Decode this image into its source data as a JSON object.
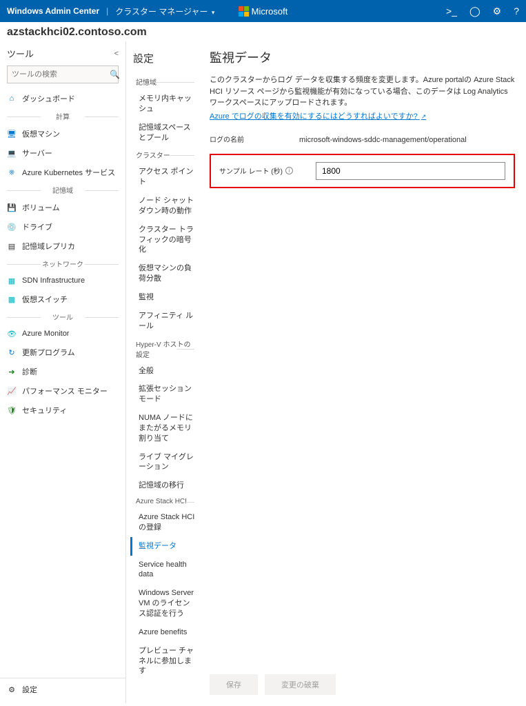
{
  "header": {
    "product": "Windows Admin Center",
    "context": "クラスター マネージャー",
    "brand": "Microsoft"
  },
  "cluster_name": "azstackhci02.contoso.com",
  "tools": {
    "title": "ツール",
    "search_placeholder": "ツールの検索",
    "items": {
      "dashboard": "ダッシュボード",
      "section_compute": "計算",
      "vm": "仮想マシン",
      "server": "サーバー",
      "aks": "Azure Kubernetes サービス",
      "section_storage": "記憶域",
      "volume": "ボリューム",
      "drive": "ドライブ",
      "storage_replica": "記憶域レプリカ",
      "section_network": "ネットワーク",
      "sdn": "SDN Infrastructure",
      "vswitch": "仮想スイッチ",
      "section_tool": "ツール",
      "azmon": "Azure Monitor",
      "updates": "更新プログラム",
      "diag": "診断",
      "perfmon": "パフォーマンス モニター",
      "security": "セキュリティ"
    },
    "footer": "設定"
  },
  "settings": {
    "title": "設定",
    "sections": {
      "storage": "記憶域",
      "cluster": "クラスター",
      "hyperv": "Hyper-V ホストの設定",
      "azurehci": "Azure Stack HCI"
    },
    "items": {
      "mem_cache": "メモリ内キャッシュ",
      "storage_space": "記憶域スペースとプール",
      "access_point": "アクセス ポイント",
      "node_shutdown": "ノード シャットダウン時の動作",
      "traffic_enc": "クラスター トラフィックの暗号化",
      "vm_lb": "仮想マシンの負荷分散",
      "monitoring": "監視",
      "affinity": "アフィニティ ルール",
      "general": "全般",
      "enh_session": "拡張セッション モード",
      "numa": "NUMA ノードにまたがるメモリ割り当て",
      "live_mig": "ライブ マイグレーション",
      "storage_mig": "記憶域の移行",
      "hci_reg": "Azure Stack HCI の登録",
      "monitor_data": "監視データ",
      "svc_health": "Service health data",
      "ws_vm_lic": "Windows Server VM のライセンス認証を行う",
      "az_benefits": "Azure benefits",
      "preview": "プレビュー チャネルに参加します"
    }
  },
  "main": {
    "title": "監視データ",
    "description": "このクラスターからログ データを収集する頻度を変更します。Azure portalの Azure Stack HCI リソース ページから監視機能が有効になっている場合、このデータは Log Analytics ワークスペースにアップロードされます。",
    "help_link": "Azure でログの収集を有効にするにはどうすればよいですか?",
    "log_name_label": "ログの名前",
    "log_name_value": "microsoft-windows-sddc-management/operational",
    "sample_rate_label": "サンプル レート (秒)",
    "sample_rate_value": "1800",
    "save_btn": "保存",
    "discard_btn": "変更の破棄"
  }
}
